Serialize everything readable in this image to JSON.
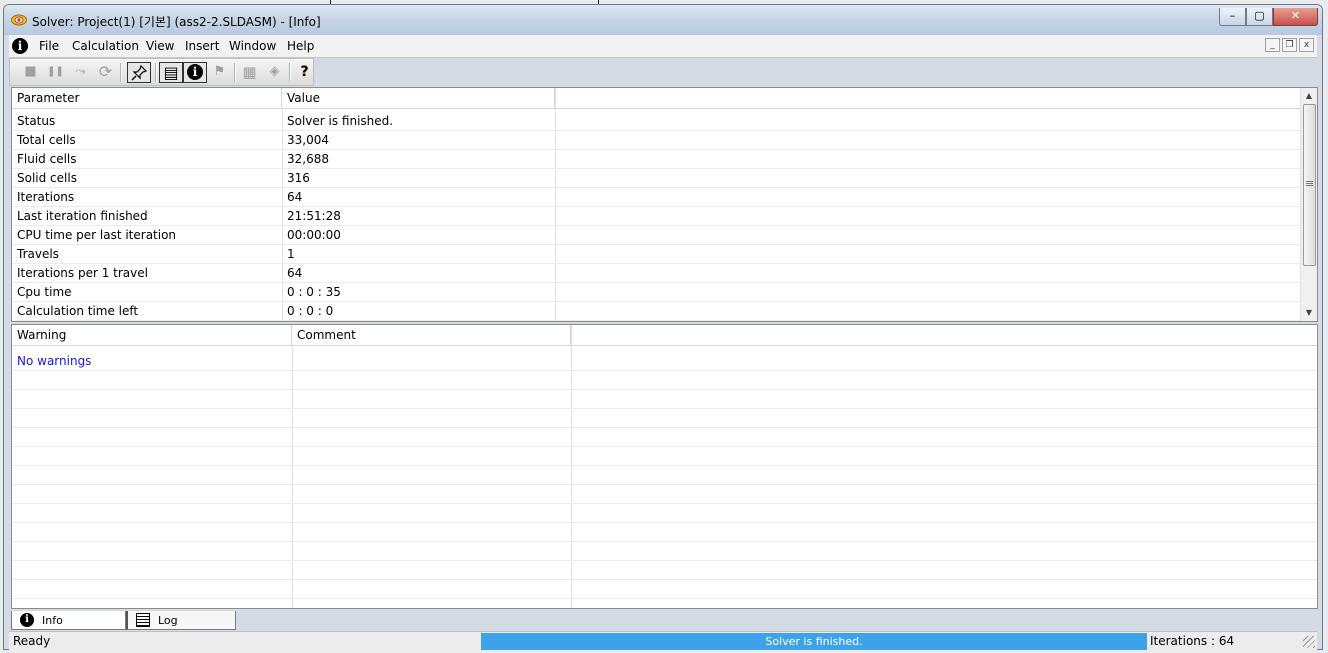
{
  "window": {
    "title": "Solver: Project(1) [기본] (ass2-2.SLDASM) - [Info]",
    "controls": {
      "minimize": "–",
      "maximize": "▢",
      "close": "✕"
    }
  },
  "menu": {
    "items": [
      "File",
      "Calculation",
      "View",
      "Insert",
      "Window",
      "Help"
    ],
    "mdi_controls": {
      "minimize": "_",
      "restore": "❐",
      "close": "x"
    }
  },
  "toolbar": {
    "buttons": [
      {
        "icon": "stop-icon",
        "glyph": "■",
        "enabled": false
      },
      {
        "icon": "pause-icon",
        "glyph": "❚❚",
        "enabled": false
      },
      {
        "icon": "insert-goal-icon",
        "glyph": "⤳",
        "enabled": false
      },
      {
        "icon": "refresh-icon",
        "glyph": "⟳",
        "enabled": false
      },
      {
        "icon": "pin-icon",
        "glyph": "📌",
        "pressed": true
      },
      {
        "icon": "log-icon",
        "glyph": "▤",
        "pressed": true
      },
      {
        "icon": "info-icon",
        "glyph": "i",
        "pressed": true
      },
      {
        "icon": "flag-icon",
        "glyph": "⚑",
        "enabled": false
      },
      {
        "icon": "grid-icon",
        "glyph": "▦",
        "enabled": false
      },
      {
        "icon": "diamond-icon",
        "glyph": "◈",
        "enabled": false
      },
      {
        "icon": "help-icon",
        "glyph": "?",
        "enabled": true
      }
    ]
  },
  "info_table": {
    "columns": [
      "Parameter",
      "Value"
    ],
    "rows": [
      {
        "parameter": "Status",
        "value": "Solver is finished."
      },
      {
        "parameter": "Total cells",
        "value": "33,004"
      },
      {
        "parameter": "Fluid cells",
        "value": "32,688"
      },
      {
        "parameter": "Solid cells",
        "value": "316"
      },
      {
        "parameter": "Iterations",
        "value": "64"
      },
      {
        "parameter": "Last iteration finished",
        "value": "21:51:28"
      },
      {
        "parameter": "CPU time per last iteration",
        "value": "00:00:00"
      },
      {
        "parameter": "Travels",
        "value": "1"
      },
      {
        "parameter": "Iterations per 1 travel",
        "value": "64"
      },
      {
        "parameter": "Cpu time",
        "value": "0 : 0 : 35"
      },
      {
        "parameter": "Calculation time left",
        "value": "0 : 0 : 0"
      }
    ]
  },
  "warnings_table": {
    "columns": [
      "Warning",
      "Comment"
    ],
    "rows": [
      {
        "warning": "No warnings",
        "comment": ""
      }
    ],
    "link_color": "#1a1acc"
  },
  "tabs": [
    {
      "label": "Info",
      "icon": "info-icon",
      "active": true
    },
    {
      "label": "Log",
      "icon": "log-icon",
      "active": false
    }
  ],
  "statusbar": {
    "status": "Ready",
    "progress_text": "Solver is finished.",
    "progress_fraction": 1.0,
    "progress_color": "#3da2e8",
    "iterations": "Iterations : 64"
  }
}
